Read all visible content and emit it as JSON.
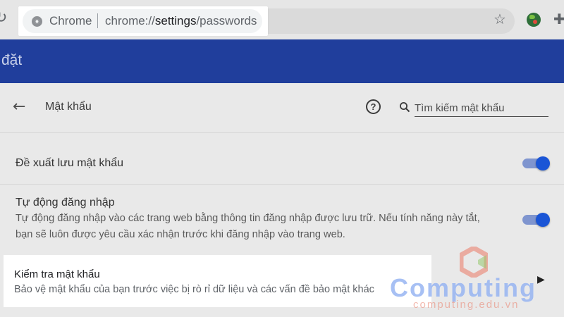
{
  "browser": {
    "site_label": "Chrome",
    "url_prefix": "chrome://",
    "url_host": "settings",
    "url_path": "/passwords",
    "icons": {
      "reload": "reload-icon",
      "site_info": "chrome-logo-icon",
      "bookmark": "star-icon",
      "extension": "globe-extension-icon",
      "extensions_menu": "puzzle-icon"
    }
  },
  "settings_header": {
    "title": "đặt"
  },
  "page": {
    "title": "Mật khẩu",
    "search_placeholder": "Tìm kiếm mật khẩu",
    "icons": {
      "back": "back-arrow-icon",
      "help": "help-icon",
      "search": "search-icon"
    }
  },
  "rows": {
    "offer_to_save": {
      "label": "Đề xuất lưu mật khẩu",
      "toggle_on": true
    },
    "auto_signin": {
      "label": "Tự động đăng nhập",
      "desc_line1": "Tự động đăng nhập vào các trang web bằng thông tin đăng nhập được lưu trữ. Nếu tính năng này tắt,",
      "desc_line2": "bạn sẽ luôn được yêu cầu xác nhận trước khi đăng nhập vào trang web.",
      "toggle_on": true
    },
    "password_check": {
      "label": "Kiểm tra mật khẩu",
      "desc": "Bảo vệ mật khẩu của bạn trước việc bị rò rỉ dữ liệu và các vấn đề bảo mật khác"
    }
  },
  "watermark": {
    "brand": "Computing",
    "url": "computing.edu.vn"
  },
  "colors": {
    "header_blue": "#203e9c",
    "toggle_knob": "#1a55d6",
    "toggle_track": "#7f95cf",
    "highlight": "#ffffff"
  }
}
